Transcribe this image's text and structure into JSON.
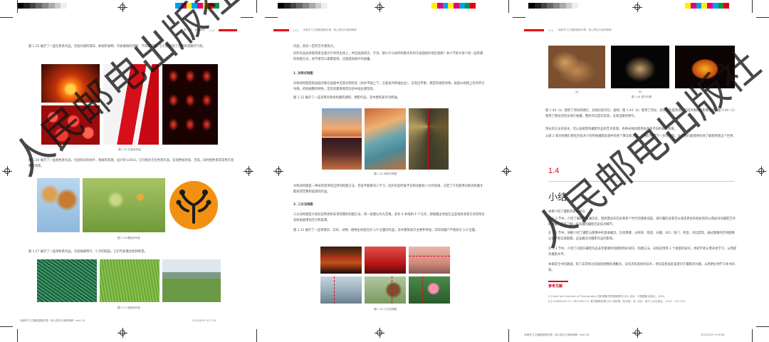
{
  "left": {
    "header_left": "第 1 章　摄影基础",
    "header_num": "(12)",
    "p1": "图 1.25 展示了一些红色系作品，包括灼烧的落日、鲜丽的食物、代表贼瑞的饰物、节日的灯笼。它们都展现了热情和温暖的气氛。",
    "cap125": "图 1.25 红色系作品",
    "p2": "图 1.26 展示了一些橙色系作品，包括秋天的树叶、新鲜的花果，设计的 LOGO。它们相对于红色系作品，呈现更加轻快、活泼，同时橙色系常常用于温馨的场景。",
    "cap126": "图 1.26 橙色系作品",
    "p3": "图 1.27 展示了一些绿色系作品，包括植被特写、5 月的稻田。它们代表着生机和希望。",
    "cap127": "图 1.27 绿色系作品",
    "footer_left": "深度学习之摄影图像处理：核心算法与案例精粹 .indd 24",
    "footer_right": "2022/8/25 9:27:34"
  },
  "middle": {
    "header_num": "(13)",
    "header_title": "深度学习之摄影图像处理：核心算法与案例精粹",
    "p0": "内容，具有一定的艺术感染力。",
    "p1": "好的作品会将观赏者注意力引导到主体上，并且画面简洁、干净。那么什么样的构图才有利于画面给好地呈现呢？本小节给大家介绍一些经典的构图方法，初学者可以掌握套用，迅速提高照片的质量。",
    "h1": "1. 对称式构图",
    "p2": "对称式构图是指画面对象在画面中呈现对称状态（如水平轴上下、沿垂直对称轴左右），呈现出平衡、稳定的视觉效果，画面从视线上有序的引导感。结构规整的特色，常见的建筑物常包括中国古建筑等。",
    "p3": "图 1.32 展示了一些采用对称式构图的建筑、倒影作品，其中建筑表示对称轴。",
    "cap132": "图 1.32 对称式构图",
    "p4": "对称式构图是一种非常简单和自然的构图方法，但往不能要深入学习，因为有些时候不对称也能给人力的协调，决定了只有使用对称式构图才能获得完整和美观的作品。",
    "h2": "2. 三分法构图",
    "p5": "三分法构图是大家比较熟悉和非常经典的构图方法，将一张图分为九宫格，会有 4 条线和 4 个交点，把被摄主体放在这些线条或者交点的附近会给画面增加活力和美感。",
    "p6": "图 1.33 展示了一些将落日、云朵、动物、植物主体放在约 1/3 位置的作品，其中建筑表示主要参考线，实际的摄户严格处在 1/3 位置。",
    "cap133": "图 1.33 三分法构图"
  },
  "right": {
    "header_num": "(13)",
    "header_title": "深度学习之摄影图像处理：核心算法与案例精粹",
    "sub_a": "（a）",
    "sub_b": "（b）",
    "sub_c": "（c）",
    "cap144": "图 1.44 居中光源",
    "p1": "图 1.44（a）使用了顶光的硬灯，光线比较均匀、柔和；图 1.44（b）使用了顶光，高光对比度更高，完成对眼睛的影像塑造；图 1.44（c）使用了侧光的逆光进行拍摄，整体对比度比较高，呈现出暖的特写。",
    "p2": "用光的方法有很多，可以直接影响摄影作品的艺术氛围，各种光线的使用会产生不同的视觉效果。",
    "p3": "从第 2 章开始我们将结合技术介绍传统摄影处理中的各个算法和方法，让我们把握下一步的操作，会让我们能够更好地了解和熟悉这个世界。",
    "sec_num": "1.4",
    "sec_title": "小结",
    "s1": "本章介绍了摄影的基础知识。",
    "s2": "在 1.1 节中，介绍了摄影的发展历史，回顾漫长的历史和各个时代的重要成就，感兴趣的读者可以阅读更多的相关资料从而加深对摄影艺术的理解，甚至了解一些有趣的摄影历史技术细节。",
    "s3": "在 1.2 节中，讲解介绍了摄影与图像中的基本概念，包括像素、分辨率、焦距、光圈、ISO、快门、色温、对比度等，通过图像的示例图像让初学者迅速掌握，这些概念对摄影作品的影响。",
    "s4": "在 1.3 节中，介绍了对提升摄影作品非常重要的构图和色彩知识、构图方法、光照运用等 3 个维度的知识，供初学者从零开始学习，从而提升摄影水平。",
    "s5": "本章是全书的基础，除了非常经过前面的图像处理概念，没有涉及具体的技术，目标是激发起读者对于摄影的兴趣，从而更好地学习本书内容。",
    "ref_title": "参考文献",
    "ref1": "[1] New York Institute of Photography. 纽约摄影学院摄影教材 [M]. 北京：中国摄影出版社，2000.",
    "ref2": "[2] GONZALEZ R C, WOODS R E. 数字图像处理 [M]. 阮秋琦，阮宇智，译. 北京：电子工业出版社，2010：197-213.",
    "footer_left": "深度学习之摄影图像处理：核心算法与案例精粹 .indd 46",
    "footer_right": "2022/8/25 9:28:08"
  },
  "watermark": "人民邮电出版社",
  "colors": {
    "accent_red": "#e60012",
    "ref_title": "#d0021b",
    "swatches": [
      "#00a0e9",
      "#e4007f",
      "#fff100",
      "#009944",
      "#e60012",
      "#1d2088"
    ]
  }
}
